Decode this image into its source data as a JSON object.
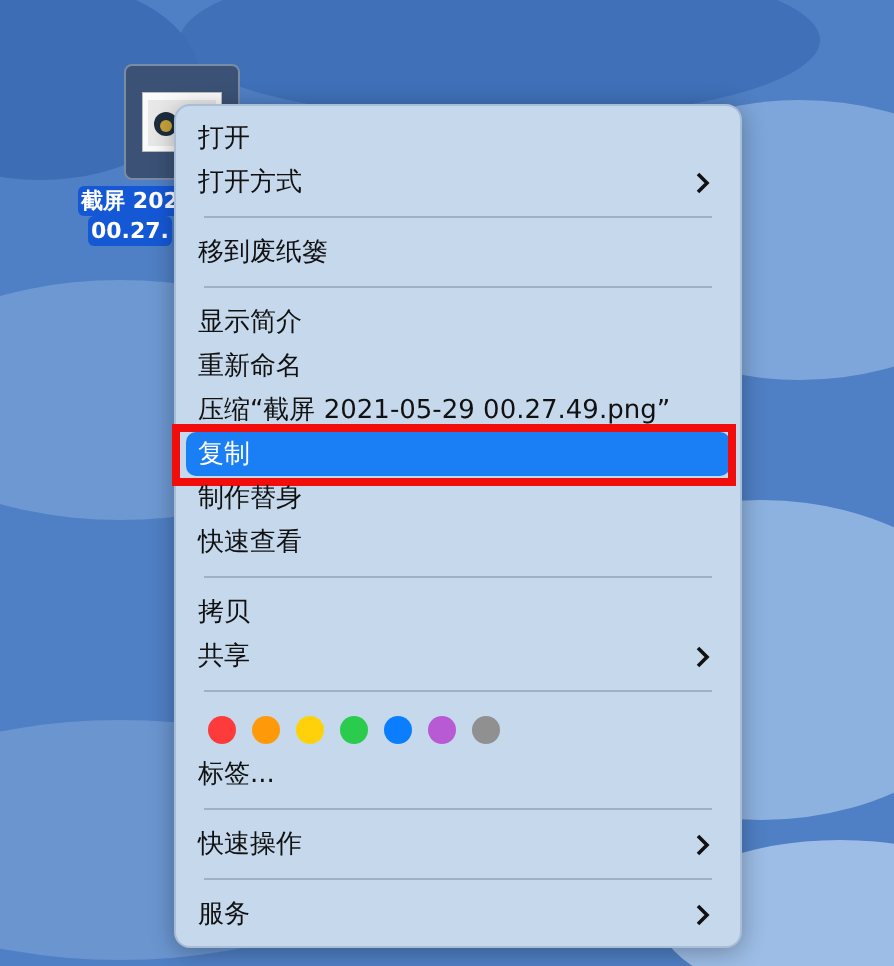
{
  "desktop_icon": {
    "label_lines": [
      "截屏 202",
      "00.27."
    ],
    "selected": true
  },
  "menu": {
    "groups": [
      [
        {
          "kind": "item",
          "label": "打开",
          "submenu": false,
          "selected": false,
          "framed": false
        },
        {
          "kind": "item",
          "label": "打开方式",
          "submenu": true,
          "selected": false,
          "framed": false
        }
      ],
      [
        {
          "kind": "item",
          "label": "移到废纸篓",
          "submenu": false,
          "selected": false,
          "framed": false
        }
      ],
      [
        {
          "kind": "item",
          "label": "显示简介",
          "submenu": false,
          "selected": false,
          "framed": false
        },
        {
          "kind": "item",
          "label": "重新命名",
          "submenu": false,
          "selected": false,
          "framed": false
        },
        {
          "kind": "item",
          "label": "压缩“截屏 2021-05-29 00.27.49.png”",
          "submenu": false,
          "selected": false,
          "framed": false
        },
        {
          "kind": "item",
          "label": "复制",
          "submenu": false,
          "selected": true,
          "framed": true
        },
        {
          "kind": "item",
          "label": "制作替身",
          "submenu": false,
          "selected": false,
          "framed": false
        },
        {
          "kind": "item",
          "label": "快速查看",
          "submenu": false,
          "selected": false,
          "framed": false
        }
      ],
      [
        {
          "kind": "item",
          "label": "拷贝",
          "submenu": false,
          "selected": false,
          "framed": false
        },
        {
          "kind": "item",
          "label": "共享",
          "submenu": true,
          "selected": false,
          "framed": false
        }
      ],
      [
        {
          "kind": "tags",
          "tags": [
            {
              "color": "#fe3b3b"
            },
            {
              "color": "#fe9a0a"
            },
            {
              "color": "#fed10a"
            },
            {
              "color": "#2bcb4e"
            },
            {
              "color": "#0a7efe"
            },
            {
              "color": "#b75ad3"
            },
            {
              "color": "#909090"
            }
          ]
        },
        {
          "kind": "item",
          "label": "标签...",
          "submenu": false,
          "selected": false,
          "framed": false
        }
      ],
      [
        {
          "kind": "item",
          "label": "快速操作",
          "submenu": true,
          "selected": false,
          "framed": false
        }
      ],
      [
        {
          "kind": "item",
          "label": "服务",
          "submenu": true,
          "selected": false,
          "framed": false
        }
      ]
    ]
  }
}
